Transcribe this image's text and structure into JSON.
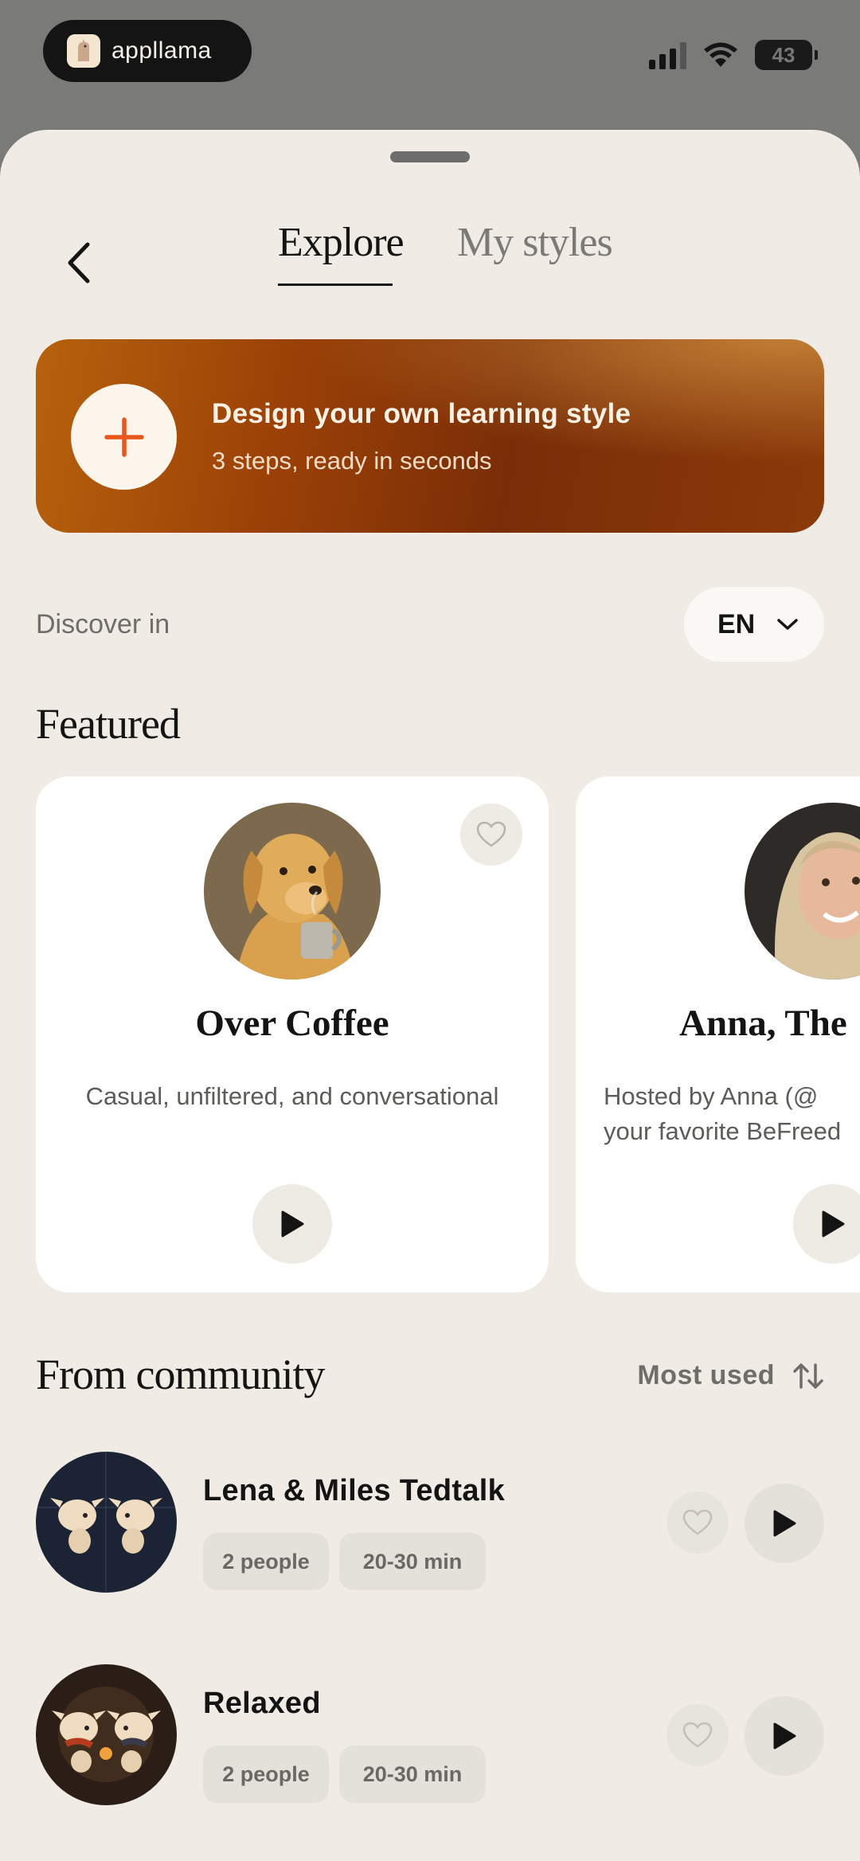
{
  "status_bar": {
    "app_name": "appllama",
    "battery": "43"
  },
  "tabs": [
    {
      "label": "Explore",
      "active": true
    },
    {
      "label": "My styles",
      "active": false
    }
  ],
  "banner": {
    "title": "Design your own learning style",
    "subtitle": "3 steps, ready in seconds"
  },
  "discover": {
    "label": "Discover in",
    "language": "EN"
  },
  "featured": {
    "heading": "Featured",
    "cards": [
      {
        "title": "Over Coffee",
        "description": "Casual, unfiltered, and conversational",
        "icon": "golden-retriever-with-coffee-avatar"
      },
      {
        "title": "Anna, The",
        "description_line1": "Hosted by Anna (@",
        "description_line2": "your favorite BeFreed",
        "icon": "woman-photo-avatar"
      }
    ]
  },
  "community": {
    "heading": "From community",
    "sort_label": "Most used",
    "items": [
      {
        "title": "Lena & Miles Tedtalk",
        "people": "2 people",
        "duration": "20-30 min"
      },
      {
        "title": "Relaxed",
        "people": "2 people",
        "duration": "20-30 min"
      }
    ]
  },
  "colors": {
    "sheet_bg": "#f0ece5",
    "accent_orange": "#e8581c",
    "banner_dark": "#7a2d07"
  }
}
